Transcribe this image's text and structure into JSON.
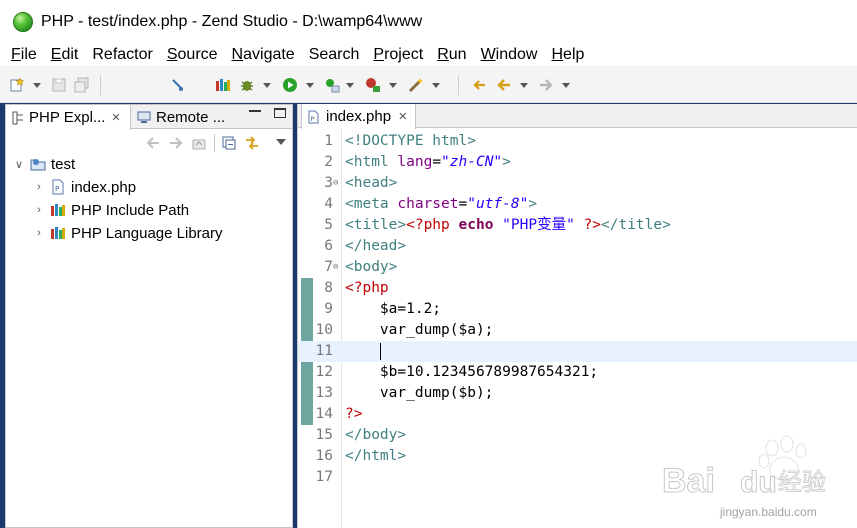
{
  "window": {
    "title": "PHP - test/index.php - Zend Studio - D:\\wamp64\\www"
  },
  "menu": {
    "items": [
      {
        "mnemonic": "F",
        "rest": "ile"
      },
      {
        "mnemonic": "E",
        "rest": "dit"
      },
      {
        "mnemonic": "",
        "rest": "Refactor"
      },
      {
        "mnemonic": "S",
        "rest": "ource"
      },
      {
        "mnemonic": "N",
        "rest": "avigate"
      },
      {
        "mnemonic": "",
        "rest": "Search"
      },
      {
        "mnemonic": "P",
        "rest": "roject"
      },
      {
        "mnemonic": "R",
        "rest": "un"
      },
      {
        "mnemonic": "W",
        "rest": "indow"
      },
      {
        "mnemonic": "H",
        "rest": "elp"
      }
    ]
  },
  "explorer": {
    "tab_active": "PHP Expl...",
    "tab_close": "✕",
    "tab_inactive": "Remote ...",
    "tree": {
      "project": "test",
      "children": [
        "index.php",
        "PHP Include Path",
        "PHP Language Library"
      ]
    }
  },
  "editor": {
    "tab_label": "index.php",
    "tab_close": "✕",
    "current_line": 11,
    "line_numbers": [
      "1",
      "2",
      "3",
      "4",
      "5",
      "6",
      "7",
      "8",
      "9",
      "10",
      "11",
      "12",
      "13",
      "14",
      "15",
      "16",
      "17"
    ],
    "lines": [
      [
        {
          "c": "tg",
          "t": "<!DOCTYPE html>"
        }
      ],
      [
        {
          "c": "tg",
          "t": "<html "
        },
        {
          "c": "at",
          "t": "lang"
        },
        {
          "c": "pl",
          "t": "="
        },
        {
          "c": "sv",
          "t": "\"zh-CN\""
        },
        {
          "c": "tg",
          "t": ">"
        }
      ],
      [
        {
          "c": "tg",
          "t": "<head>"
        }
      ],
      [
        {
          "c": "tg",
          "t": "<meta "
        },
        {
          "c": "at",
          "t": "charset"
        },
        {
          "c": "pl",
          "t": "="
        },
        {
          "c": "sv",
          "t": "\"utf-8\""
        },
        {
          "c": "tg",
          "t": ">"
        }
      ],
      [
        {
          "c": "tg",
          "t": "<title>"
        },
        {
          "c": "ph",
          "t": "<?php "
        },
        {
          "c": "kw",
          "t": "echo"
        },
        {
          "c": "pl",
          "t": " "
        },
        {
          "c": "st",
          "t": "\"PHP变量\""
        },
        {
          "c": "pl",
          "t": " "
        },
        {
          "c": "ph",
          "t": "?>"
        },
        {
          "c": "tg",
          "t": "</title>"
        }
      ],
      [
        {
          "c": "tg",
          "t": "</head>"
        }
      ],
      [
        {
          "c": "tg",
          "t": "<body>"
        }
      ],
      [
        {
          "c": "ph",
          "t": "<?php"
        }
      ],
      [
        {
          "c": "pl",
          "t": "    $a=1.2;"
        }
      ],
      [
        {
          "c": "pl",
          "t": "    var_dump($a);"
        }
      ],
      [
        {
          "c": "pl",
          "t": "    "
        }
      ],
      [
        {
          "c": "pl",
          "t": "    $b=10.123456789987654321;"
        }
      ],
      [
        {
          "c": "pl",
          "t": "    var_dump($b);"
        }
      ],
      [
        {
          "c": "ph",
          "t": "?>"
        }
      ],
      [
        {
          "c": "tg",
          "t": "</body>"
        }
      ],
      [
        {
          "c": "tg",
          "t": "</html>"
        }
      ],
      []
    ],
    "folds": [
      3,
      7
    ]
  },
  "watermark": {
    "brand": "Bai",
    "brand2": "du",
    "cn": "经验",
    "url": "jingyan.baidu.com"
  },
  "colors": {
    "tag": "#3f7f7f",
    "attr": "#7f007f",
    "attr_value": "#2a00ff",
    "php_delim": "#c00000",
    "keyword": "#7f0055",
    "current_line_bg": "#e8f2fe",
    "ruler": "#6fa6a0"
  }
}
